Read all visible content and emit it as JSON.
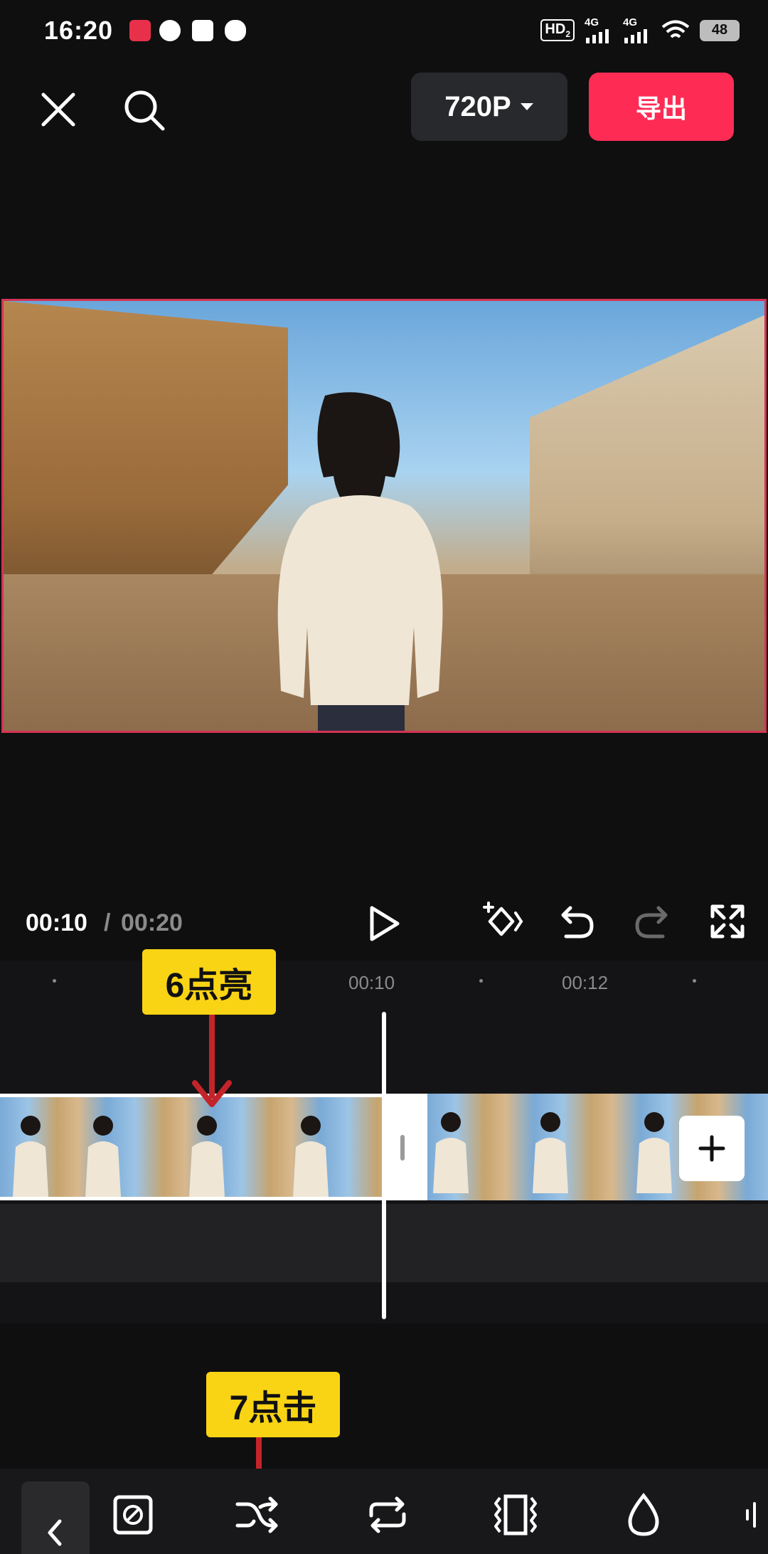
{
  "status_bar": {
    "time": "16:20",
    "hd_badge": "HD",
    "hd_sub": "2",
    "signal_1": "4G",
    "signal_2": "4G",
    "battery": "48"
  },
  "toolbar": {
    "resolution_label": "720P",
    "export_label": "导出"
  },
  "playback": {
    "current_time": "00:10",
    "separator": "/",
    "total_time": "00:20"
  },
  "timeline": {
    "ruler_labels": [
      "00:10",
      "00:12"
    ]
  },
  "annotations": {
    "step6": "6点亮",
    "step7": "7点击"
  },
  "colors": {
    "accent": "#fe2c55",
    "callout": "#f9d414",
    "background": "#0f0f10"
  },
  "icons": [
    "close-icon",
    "search-icon",
    "play-icon",
    "keyframe-icon",
    "undo-icon",
    "redo-icon",
    "fullscreen-icon",
    "add-icon",
    "back-icon",
    "no-fill-icon",
    "shuffle-icon",
    "loop-icon",
    "stretch-icon",
    "drop-icon"
  ]
}
